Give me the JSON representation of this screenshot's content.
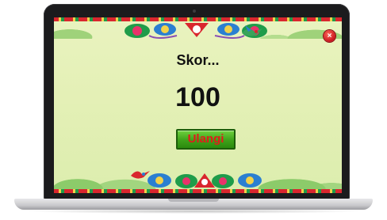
{
  "game": {
    "score_label": "Skor...",
    "score_value": "100",
    "retry_label": "Ulangi",
    "close_icon": "close-icon",
    "close_glyph": "×"
  },
  "colors": {
    "background": "#e6f1b8",
    "retry_button_fill": "#3ea21a",
    "retry_button_text": "#e11b1b",
    "close_button_fill": "#c8141e",
    "score_text": "#111111"
  }
}
